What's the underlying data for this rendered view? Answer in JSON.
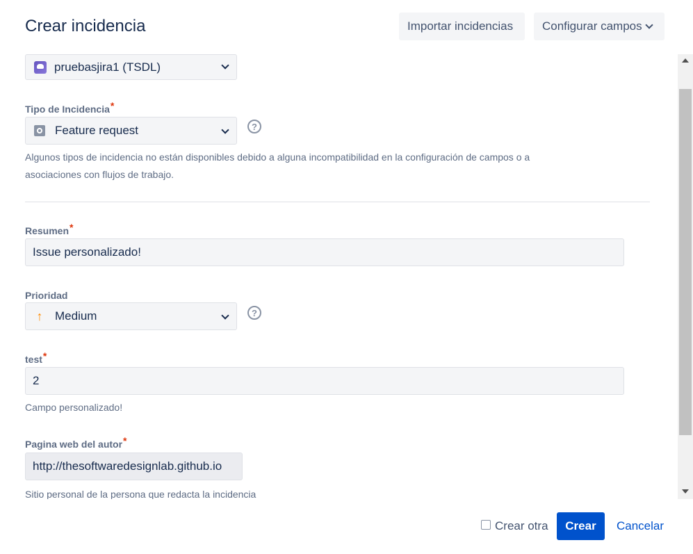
{
  "header": {
    "title": "Crear incidencia",
    "import_label": "Importar incidencias",
    "configure_label": "Configurar campos"
  },
  "project": {
    "value": "pruebasjira1 (TSDL)",
    "icon": "project-avatar-icon"
  },
  "issue_type": {
    "label": "Tipo de Incidencia",
    "required_mark": "*",
    "value": "Feature request",
    "icon": "feature-request-icon",
    "help": "?",
    "description_line1": "Algunos tipos de incidencia no están disponibles debido a alguna incompatibilidad en la configuración de campos o a",
    "description_line2": "asociaciones con flujos de trabajo."
  },
  "summary": {
    "label": "Resumen",
    "required_mark": "*",
    "value": "Issue personalizado!"
  },
  "priority": {
    "label": "Prioridad",
    "value": "Medium",
    "icon": "priority-medium-arrow-icon",
    "help": "?"
  },
  "test": {
    "label": "test",
    "required_mark": "*",
    "value": "2",
    "description": "Campo personalizado!"
  },
  "author_page": {
    "label": "Pagina web del autor",
    "required_mark": "*",
    "value": "http://thesoftwaredesignlab.github.io",
    "description": "Sitio personal de la persona que redacta la incidencia"
  },
  "footer": {
    "create_another_label": "Crear otra",
    "create_label": "Crear",
    "cancel_label": "Cancelar"
  },
  "colors": {
    "primary": "#0052cc",
    "required": "#de350b",
    "priority_medium": "#ff8b00"
  }
}
